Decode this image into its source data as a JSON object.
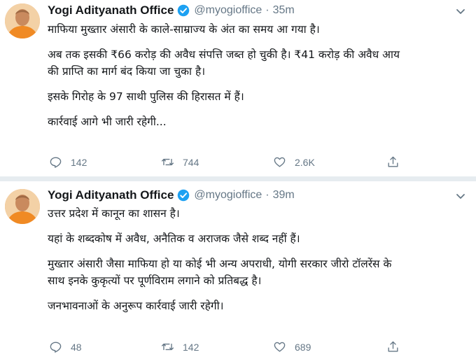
{
  "tweets": [
    {
      "author": "Yogi Adityanath Office",
      "handle": "@myogioffice",
      "separator": "·",
      "time": "35m",
      "paragraphs": [
        [
          "माफिया मुख्तार अंसारी के काले-साम्राज्य के अंत का समय आ गया है।"
        ],
        [
          "अब तक इसकी ₹66 करोड़ की अवैध संपत्ति जब्त हो चुकी है। ₹41 करोड़ की अवैध आय",
          "की प्राप्ति का मार्ग बंद किया जा चुका है।"
        ],
        [
          "इसके गिरोह के 97 साथी पुलिस की हिरासत में हैं।"
        ],
        [
          "कार्रवाई आगे भी जारी रहेगी..."
        ]
      ],
      "replies": "142",
      "retweets": "744",
      "likes": "2.6K"
    },
    {
      "author": "Yogi Adityanath Office",
      "handle": "@myogioffice",
      "separator": "·",
      "time": "39m",
      "paragraphs": [
        [
          "उत्तर प्रदेश में कानून का शासन है।"
        ],
        [
          "यहां के शब्दकोष में अवैध, अनैतिक व अराजक जैसे शब्द नहीं हैं।"
        ],
        [
          "मुख्तार अंसारी जैसा माफिया हो या कोई भी अन्य अपराधी, योगी सरकार जीरो टॉलरेंस के",
          "साथ इनके कुकृत्यों पर पूर्णविराम लगाने को प्रतिबद्ध है।"
        ],
        [
          "जनभावनाओं के अनुरूप कार्रवाई जारी रहेगी।"
        ]
      ],
      "replies": "48",
      "retweets": "142",
      "likes": "689"
    }
  ],
  "colors": {
    "text": "#14171a",
    "muted": "#657786",
    "verified": "#1da1f2",
    "divider": "#e6ecf0",
    "avatar_bg": "#f2a35a"
  },
  "icons": {
    "verified": "verified-badge-icon",
    "caret": "chevron-down-icon",
    "reply": "reply-icon",
    "retweet": "retweet-icon",
    "like": "heart-icon",
    "share": "share-icon"
  }
}
